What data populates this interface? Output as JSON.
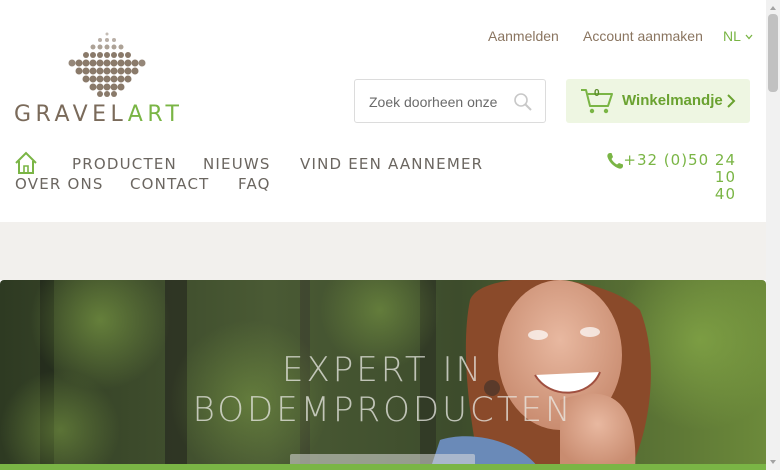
{
  "logo": {
    "part1": "GRAVEL",
    "part2": "ART"
  },
  "toplinks": {
    "login": "Aanmelden",
    "register": "Account aanmaken",
    "language": "NL"
  },
  "search": {
    "placeholder": "Zoek doorheen onze"
  },
  "cart": {
    "count": "0",
    "label": "Winkelmandje"
  },
  "nav": {
    "items": [
      "PRODUCTEN",
      "NIEUWS",
      "VIND EEN AANNEMER",
      "OVER ONS",
      "CONTACT",
      "FAQ"
    ]
  },
  "contact": {
    "phone_line1": "+32 (0)50 24 10",
    "phone_line2": "40"
  },
  "hero": {
    "line1": "EXPERT IN",
    "line2": "BODEMPRODUCTEN"
  },
  "colors": {
    "accent": "#7ab545",
    "brown": "#8a7560",
    "band": "#f2f0ed"
  },
  "icons": [
    "home-icon",
    "search-icon",
    "cart-icon",
    "chevron-right-icon",
    "phone-icon",
    "chevron-down-icon"
  ]
}
